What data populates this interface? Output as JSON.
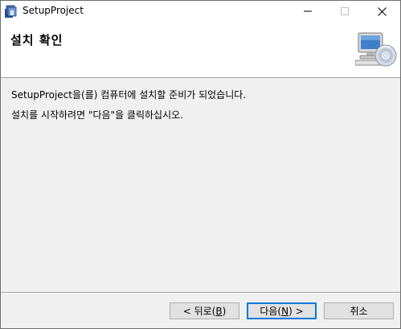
{
  "window": {
    "title": "SetupProject",
    "minimize_glyph": "—",
    "maximize_glyph": "☐",
    "close_glyph": "✕"
  },
  "header": {
    "title": "설치 확인",
    "art_icon": "computer-cd-icon"
  },
  "body": {
    "line1": "SetupProject을(를) 컴퓨터에 설치할 준비가 되었습니다.",
    "line2": "설치를 시작하려면 \"다음\"을 클릭하십시오."
  },
  "buttons": {
    "back": {
      "prefix": "< 뒤로(",
      "mnemonic": "B",
      "suffix": ")"
    },
    "next": {
      "prefix": "다음(",
      "mnemonic": "N",
      "suffix": ") >"
    },
    "cancel": {
      "label": "취소"
    }
  },
  "colors": {
    "default_button_border": "#0078d7",
    "window_background": "#f0f0f0"
  }
}
